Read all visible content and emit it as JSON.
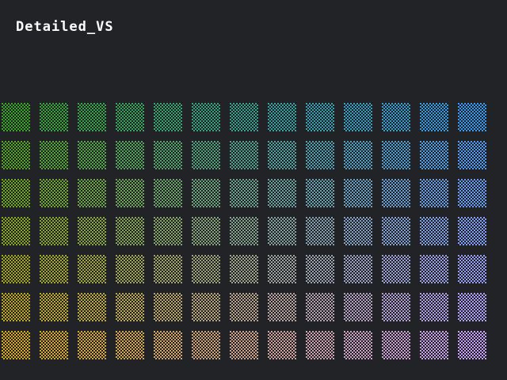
{
  "title": "Detailed_VS",
  "palette": {
    "background": "#222326",
    "checker_dark": "#1e1f22",
    "columns": 13,
    "rows": 7,
    "corner_top_left": "#3aa62a",
    "corner_top_right": "#3a9af0",
    "corner_bottom_left": "#d8a820",
    "corner_bottom_right": "#c8a0f8"
  }
}
